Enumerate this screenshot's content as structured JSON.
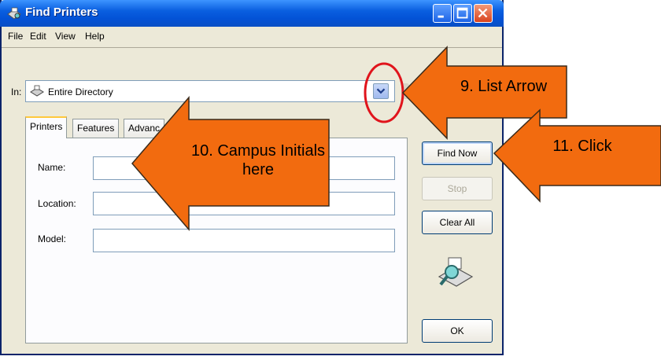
{
  "window": {
    "title": "Find Printers"
  },
  "menu": [
    {
      "label": "File"
    },
    {
      "label": "Edit"
    },
    {
      "label": "View"
    },
    {
      "label": "Help"
    }
  ],
  "scope": {
    "label": "In:",
    "value": "Entire Directory"
  },
  "tabs": [
    {
      "label": "Printers",
      "active": true
    },
    {
      "label": "Features",
      "active": false
    },
    {
      "label": "Advanc",
      "active": false
    }
  ],
  "fields": [
    {
      "label": "Name:",
      "value": ""
    },
    {
      "label": "Location:",
      "value": ""
    },
    {
      "label": "Model:",
      "value": ""
    }
  ],
  "buttons": {
    "find_now": "Find Now",
    "stop": "Stop",
    "clear_all": "Clear All",
    "ok": "OK"
  },
  "annotations": {
    "list_arrow": "9. List Arrow",
    "campus_initials_line1": "10. Campus Initials",
    "campus_initials_line2": "here",
    "click": "11. Click",
    "arrow_color": "#f26b0f",
    "circle_color": "#e0141c"
  }
}
